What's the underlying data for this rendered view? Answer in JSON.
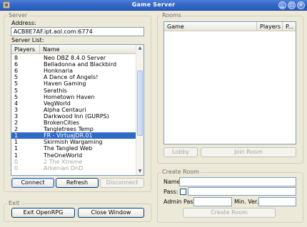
{
  "window": {
    "title": "Game Server"
  },
  "server": {
    "group_label": "Server",
    "address_label": "Address:",
    "address_value": "ACB8E7AF.ipt.aol.com:6774",
    "list_label": "Server List:",
    "columns": [
      "Players",
      "Name"
    ],
    "rows": [
      {
        "players": "8",
        "name": "Neo DBZ 8.4.0 Server"
      },
      {
        "players": "6",
        "name": "Belladonna and Blackbird"
      },
      {
        "players": "6",
        "name": "Honknaria"
      },
      {
        "players": "5",
        "name": "A Dance of Angels!"
      },
      {
        "players": "5",
        "name": "Haven Gaming"
      },
      {
        "players": "5",
        "name": "Serathis"
      },
      {
        "players": "5",
        "name": "Hometown Haven"
      },
      {
        "players": "4",
        "name": "VegWorld"
      },
      {
        "players": "3",
        "name": "Alpha Centauri"
      },
      {
        "players": "3",
        "name": "Darkwood Inn (GURPS)"
      },
      {
        "players": "2",
        "name": "BrokenCities"
      },
      {
        "players": "2",
        "name": "Tangletrees Temp"
      },
      {
        "players": "1",
        "name": "FR - VirtuaJDR.01"
      },
      {
        "players": "1",
        "name": "Skirmish Wargaming"
      },
      {
        "players": "1",
        "name": "The Tangled Web"
      },
      {
        "players": "1",
        "name": "TheOneWorld"
      },
      {
        "players": "0",
        "name": "2 The Xtreme"
      },
      {
        "players": "0",
        "name": "Arkenian DnD"
      }
    ],
    "selected_index": 12,
    "dim_from_index": 16,
    "connect_label": "Connect",
    "refresh_label": "Refresh",
    "disconnect_label": "Disconnect"
  },
  "rooms": {
    "group_label": "Rooms",
    "columns": [
      "Game",
      "Players",
      "P..."
    ],
    "lobby_label": "Lobby",
    "join_label": "Join Room"
  },
  "create_room": {
    "group_label": "Create Room",
    "name_label": "Name:",
    "name_value": "",
    "pass_label": "Pass:",
    "admin_pass_label": "Admin Pass:",
    "min_ver_label": "Min. Ver.:",
    "create_label": "Create Room"
  },
  "exit": {
    "group_label": "Exit",
    "exit_label": "Exit OpenRPG",
    "close_label": "Close Window"
  },
  "icons": {
    "app": "app-icon",
    "minimize": "minimize-icon",
    "maximize": "maximize-icon",
    "close": "close-icon"
  },
  "colors": {
    "titlebar": "#3468c9",
    "selection": "#316ac5",
    "window_bg": "#ece9d8"
  }
}
